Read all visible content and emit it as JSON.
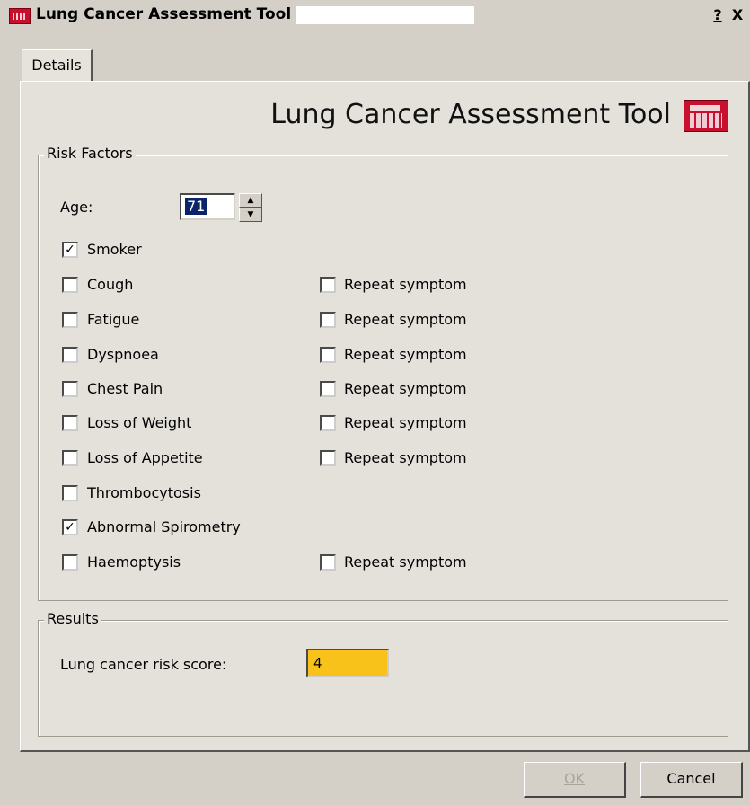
{
  "window": {
    "title": "Lung Cancer Assessment Tool -",
    "help_button": "?",
    "close_button": "X"
  },
  "tabs": [
    {
      "label": "Details"
    }
  ],
  "header": {
    "title": "Lung Cancer Assessment Tool",
    "icon": "calculator-icon"
  },
  "risk_factors": {
    "legend": "Risk Factors",
    "age_label": "Age:",
    "age_value": "71",
    "smoker": {
      "label": "Smoker",
      "checked": true
    },
    "symptoms": [
      {
        "label": "Cough",
        "checked": false,
        "repeat_label": "Repeat symptom",
        "repeat_checked": false
      },
      {
        "label": "Fatigue",
        "checked": false,
        "repeat_label": "Repeat symptom",
        "repeat_checked": false
      },
      {
        "label": "Dyspnoea",
        "checked": false,
        "repeat_label": "Repeat symptom",
        "repeat_checked": false
      },
      {
        "label": "Chest Pain",
        "checked": false,
        "repeat_label": "Repeat symptom",
        "repeat_checked": false
      },
      {
        "label": "Loss of Weight",
        "checked": false,
        "repeat_label": "Repeat symptom",
        "repeat_checked": false
      },
      {
        "label": "Loss of Appetite",
        "checked": false,
        "repeat_label": "Repeat symptom",
        "repeat_checked": false
      },
      {
        "label": "Thrombocytosis",
        "checked": false
      },
      {
        "label": "Abnormal Spirometry",
        "checked": true
      },
      {
        "label": "Haemoptysis",
        "checked": false,
        "repeat_label": "Repeat symptom",
        "repeat_checked": false
      }
    ]
  },
  "results": {
    "legend": "Results",
    "score_label": "Lung cancer risk score:",
    "score_value": "4",
    "score_color": "#f9c21a"
  },
  "buttons": {
    "ok": "OK",
    "cancel": "Cancel"
  },
  "checkmark": "✓"
}
